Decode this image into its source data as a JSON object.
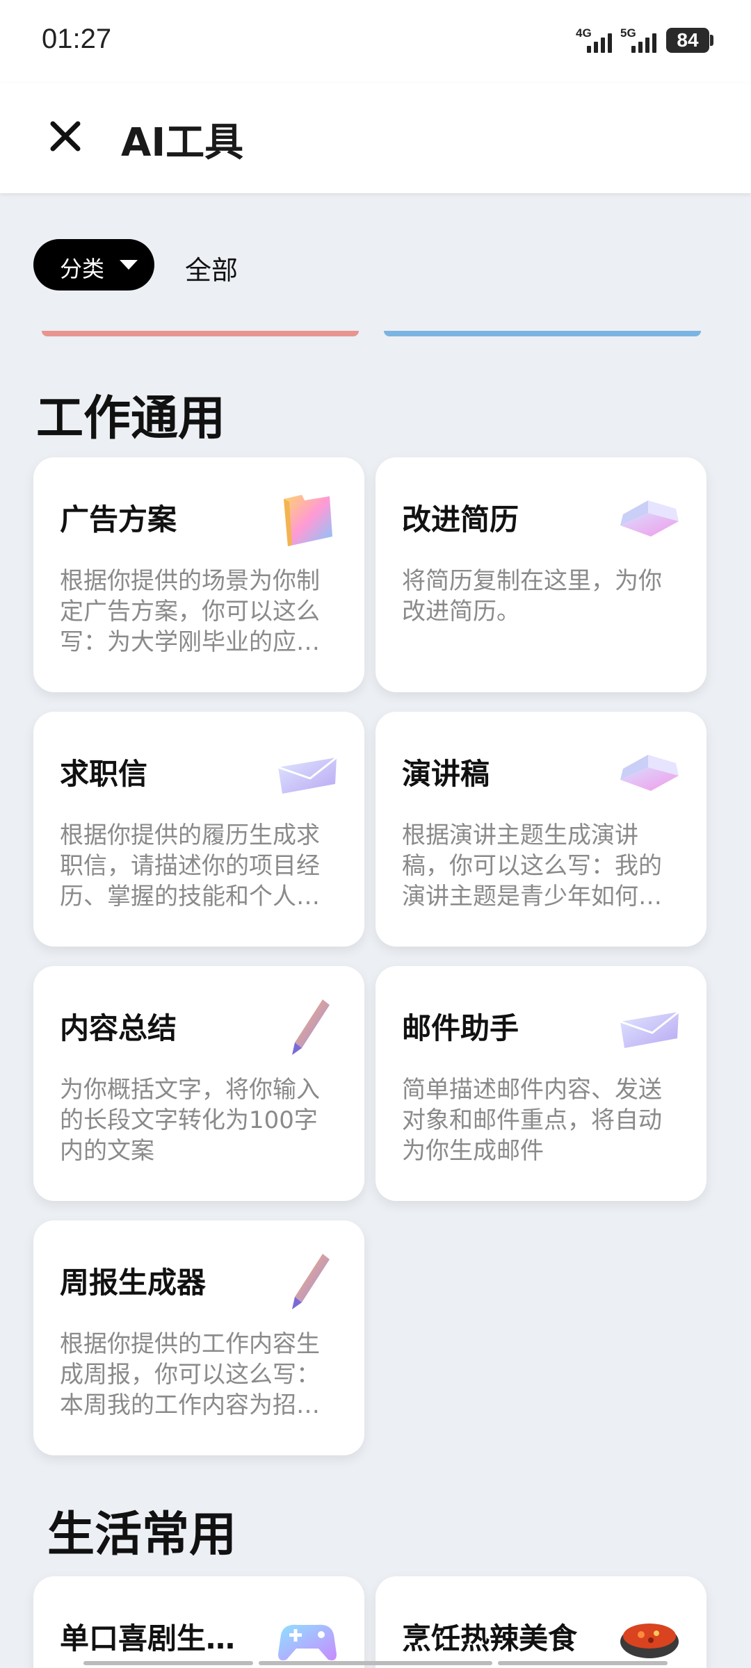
{
  "status": {
    "time": "01:27",
    "net1": "4G",
    "net2": "5G",
    "battery": "84"
  },
  "header": {
    "title": "AI工具"
  },
  "filter": {
    "category_label": "分类",
    "all_label": "全部"
  },
  "sections": [
    {
      "title": "工作通用",
      "cards": [
        {
          "title": "广告方案",
          "desc": "根据你提供的场景为你制定广告方案，你可以这么写：为大学刚毕业的应…",
          "icon": "folder-icon"
        },
        {
          "title": "改进简历",
          "desc": "将简历复制在这里，为你改进简历。",
          "icon": "book-icon"
        },
        {
          "title": "求职信",
          "desc": "根据你提供的履历生成求职信，请描述你的项目经历、掌握的技能和个人…",
          "icon": "envelope-icon"
        },
        {
          "title": "演讲稿",
          "desc": "根据演讲主题生成演讲稿，你可以这么写：我的演讲主题是青少年如何…",
          "icon": "book-icon"
        },
        {
          "title": "内容总结",
          "desc": "为你概括文字，将你输入的长段文字转化为100字内的文案",
          "icon": "pen-icon"
        },
        {
          "title": "邮件助手",
          "desc": "简单描述邮件内容、发送对象和邮件重点，将自动为你生成邮件",
          "icon": "envelope-icon"
        },
        {
          "title": "周报生成器",
          "desc": "根据你提供的工作内容生成周报，你可以这么写：本周我的工作内容为招…",
          "icon": "pen-icon"
        }
      ]
    },
    {
      "title": "生活常用",
      "cards": [
        {
          "title": "单口喜剧生…",
          "icon": "gamepad-icon"
        },
        {
          "title": "烹饪热辣美食",
          "icon": "hotpot-icon"
        }
      ]
    }
  ]
}
